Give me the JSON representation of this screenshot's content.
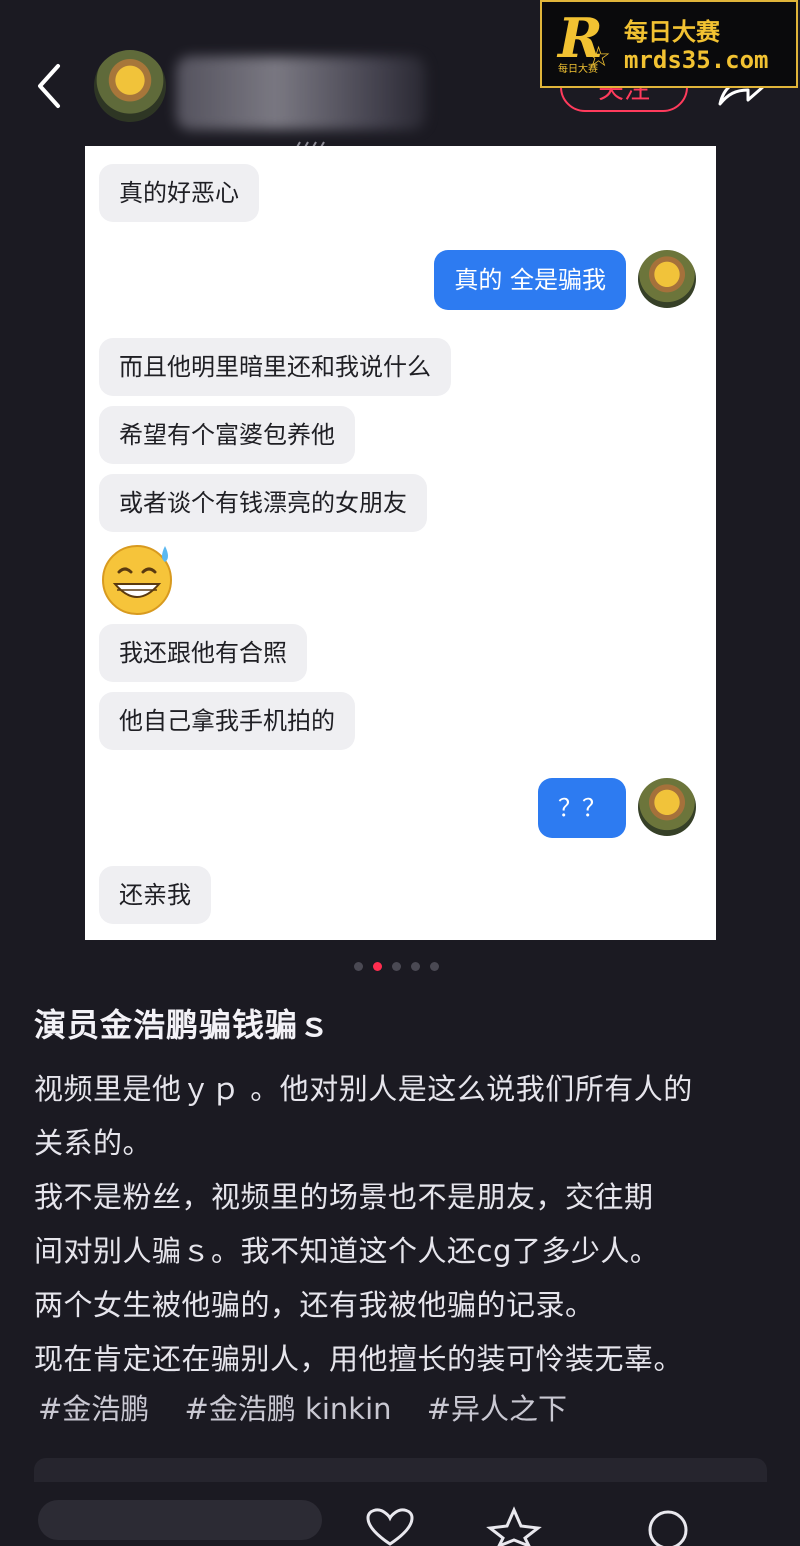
{
  "header": {
    "follow_label": "关注",
    "watermark": {
      "logo_letter": "R",
      "logo_small": "每日大赛",
      "title": "每日大赛",
      "url": "mrds35.com"
    }
  },
  "chat": {
    "messages": [
      {
        "side": "in",
        "text": "真的好恶心"
      },
      {
        "side": "out",
        "text": "真的 全是骗我"
      },
      {
        "side": "in",
        "text": "而且他明里暗里还和我说什么"
      },
      {
        "side": "in",
        "text": "希望有个富婆包养他"
      },
      {
        "side": "in",
        "text": "或者谈个有钱漂亮的女朋友"
      },
      {
        "side": "in",
        "text": "我还跟他有合照"
      },
      {
        "side": "in",
        "text": "他自己拿我手机拍的"
      },
      {
        "side": "out",
        "text": "？？"
      },
      {
        "side": "in",
        "text": "还亲我"
      }
    ],
    "emoji": "sweat-smile-emoji"
  },
  "pagination": {
    "count": 5,
    "active": 2
  },
  "post": {
    "title": "演员金浩鹏骗钱骗ｓ",
    "lines": [
      "视频里是他ｙｐ 。他对别人是这么说我们所有人的",
      "关系的。",
      "我不是粉丝，视频里的场景也不是朋友，交往期",
      "间对别人骗ｓ。我不知道这个人还cg了多少人。",
      "两个女生被他骗的，还有我被他骗的记录。",
      "现在肯定还在骗别人，用他擅长的装可怜装无辜。"
    ],
    "tags": [
      "#金浩鹏",
      "#金浩鹏 kinkin",
      "#异人之下"
    ]
  },
  "colors": {
    "background": "#1b1a22",
    "accent": "#ff3b5c",
    "bubble_out": "#2d7bf1",
    "bubble_in": "#efeff2"
  }
}
